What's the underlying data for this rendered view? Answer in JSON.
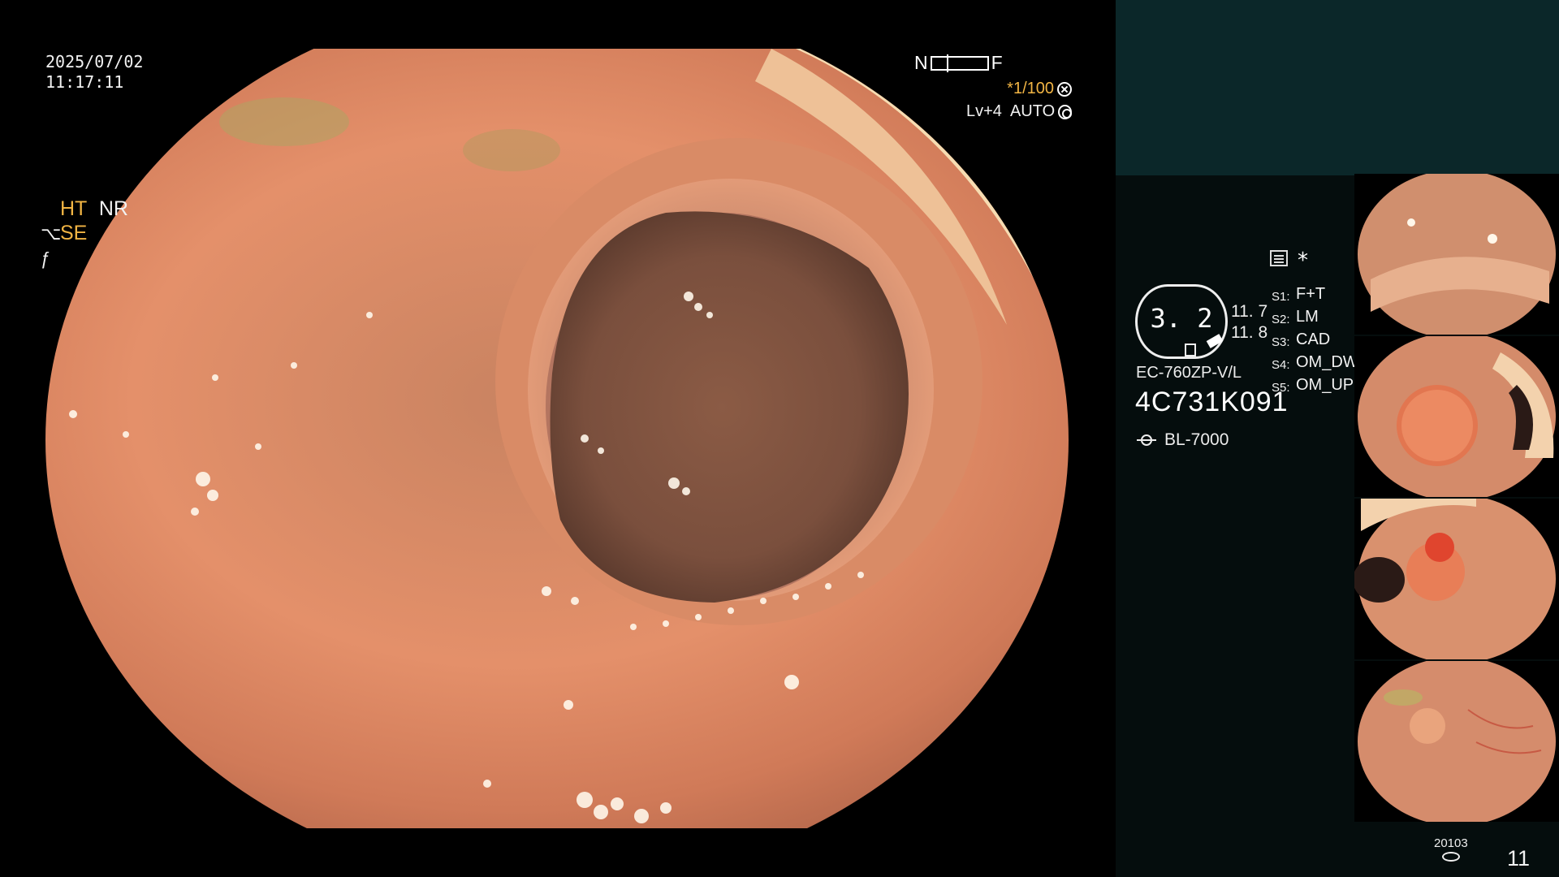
{
  "capture": {
    "date": "2025/07/02",
    "time": "11:17:11"
  },
  "focus": {
    "near_label": "N",
    "far_label": "F"
  },
  "exposure": {
    "shutter": "*1/100",
    "level": "Lv+4",
    "iris": "AUTO"
  },
  "image_modes": {
    "ht": "HT",
    "nr": "NR",
    "se": "SE"
  },
  "panel": {
    "marker": "*",
    "zoom_value": "3. 2",
    "value_a": "11. 7",
    "value_b": "11. 8",
    "switches": [
      {
        "key": "S1:",
        "value": "F+T"
      },
      {
        "key": "S2:",
        "value": "LM"
      },
      {
        "key": "S3:",
        "value": "CAD"
      },
      {
        "key": "S4:",
        "value": "OM_DW"
      },
      {
        "key": "S5:",
        "value": "OM_UP"
      }
    ],
    "scope_model": "EC-760ZP-V/L",
    "scope_serial": "4C731K091",
    "light_source": "BL-7000"
  },
  "storage": {
    "label": "20103",
    "image_count": "11"
  },
  "icons": {
    "aperture": "aperture-icon",
    "auto": "auto-iris-icon",
    "settings": "settings-icon",
    "light": "light-source-icon",
    "storage": "storage-icon"
  },
  "colors": {
    "accent": "#f2b544",
    "panel_top": "#0b2729",
    "panel": "#050d0d"
  }
}
